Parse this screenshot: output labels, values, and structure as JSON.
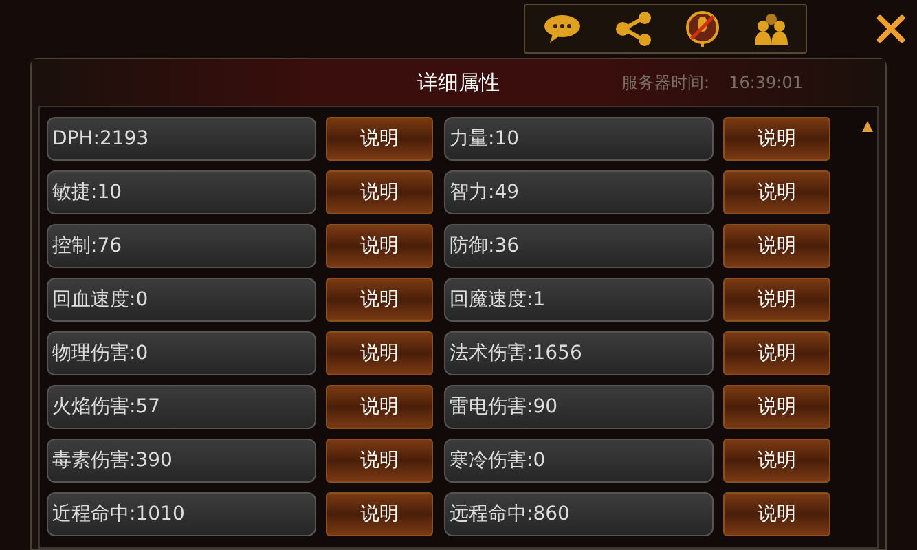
{
  "toolbar": {
    "icons": [
      {
        "kind": "chat"
      },
      {
        "kind": "share"
      },
      {
        "kind": "no-talk"
      },
      {
        "kind": "group"
      }
    ]
  },
  "panel": {
    "title": "详细属性",
    "server_time_label": "服务器时间:",
    "server_time": "16:39:01"
  },
  "attributes": [
    {
      "label": "DPH:2193",
      "button": "说明"
    },
    {
      "label": "力量:10",
      "button": "说明"
    },
    {
      "label": "敏捷:10",
      "button": "说明"
    },
    {
      "label": "智力:49",
      "button": "说明"
    },
    {
      "label": "控制:76",
      "button": "说明"
    },
    {
      "label": "防御:36",
      "button": "说明"
    },
    {
      "label": "回血速度:0",
      "button": "说明"
    },
    {
      "label": "回魔速度:1",
      "button": "说明"
    },
    {
      "label": "物理伤害:0",
      "button": "说明"
    },
    {
      "label": "法术伤害:1656",
      "button": "说明"
    },
    {
      "label": "火焰伤害:57",
      "button": "说明"
    },
    {
      "label": "雷电伤害:90",
      "button": "说明"
    },
    {
      "label": "毒素伤害:390",
      "button": "说明"
    },
    {
      "label": "寒冷伤害:0",
      "button": "说明"
    },
    {
      "label": "近程命中:1010",
      "button": "说明"
    },
    {
      "label": "远程命中:860",
      "button": "说明"
    }
  ]
}
